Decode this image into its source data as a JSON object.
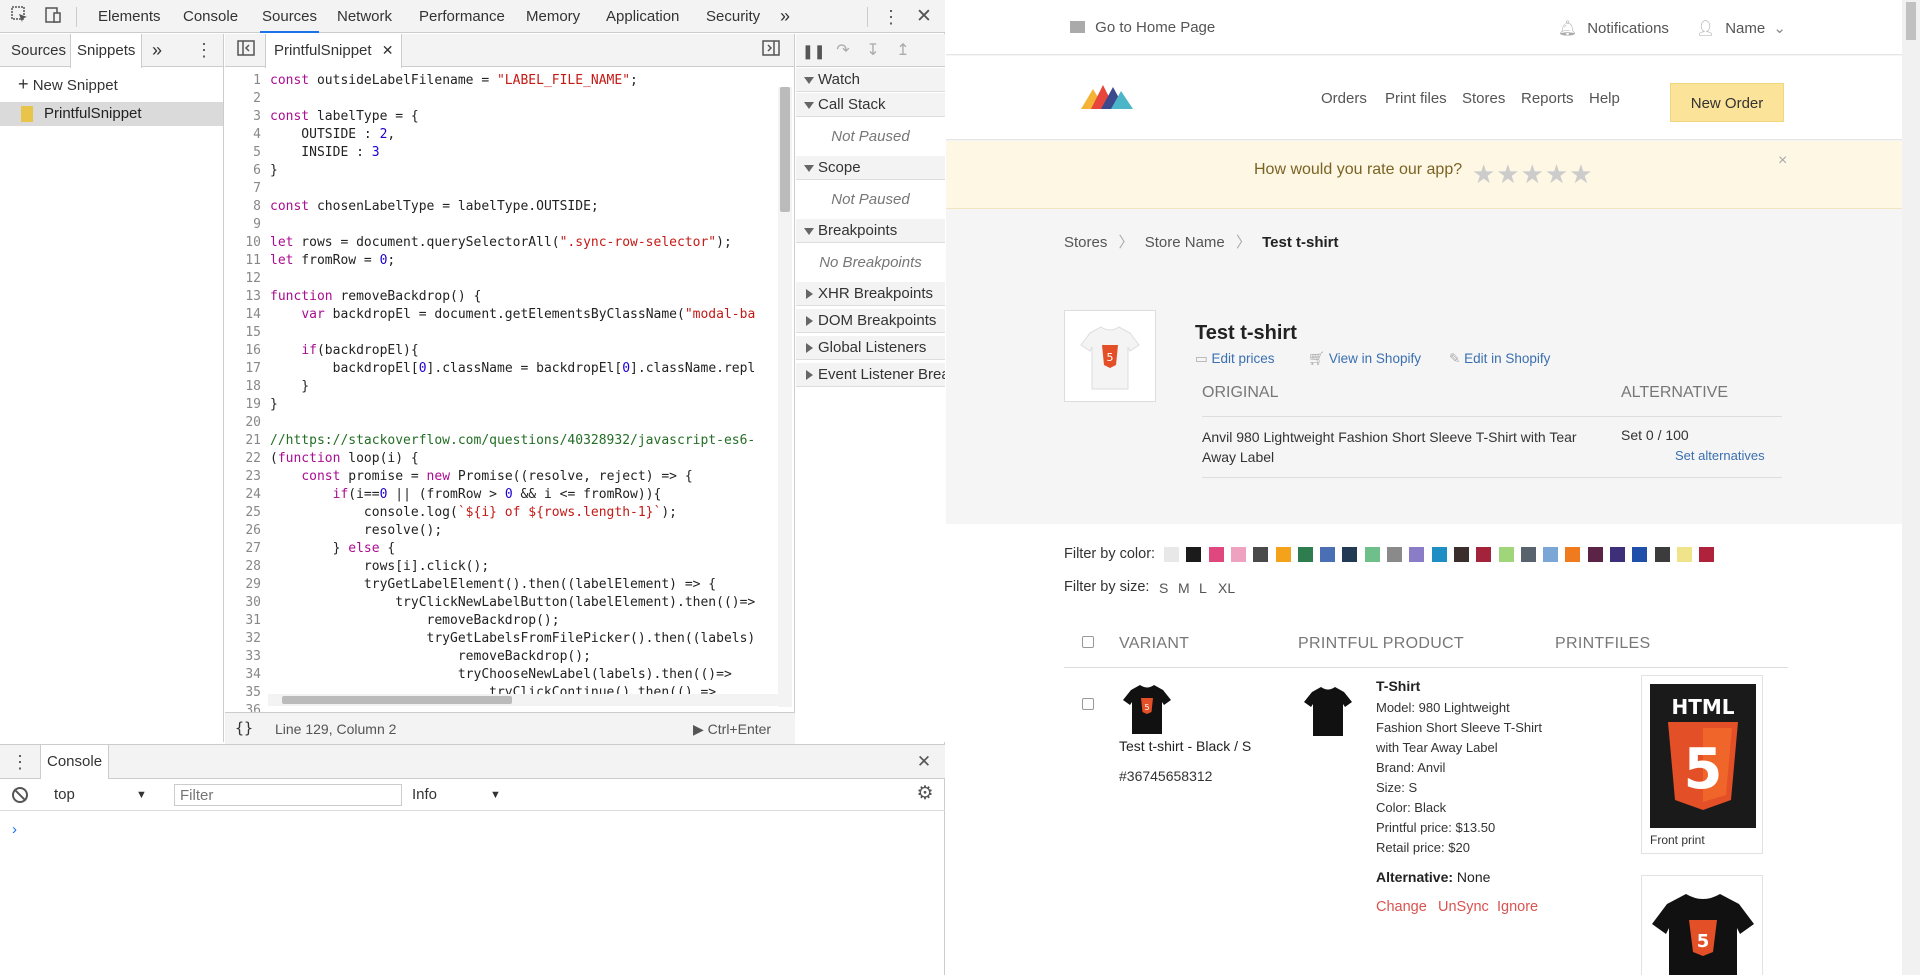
{
  "devtools": {
    "main_tabs": [
      "Elements",
      "Console",
      "Sources",
      "Network",
      "Performance",
      "Memory",
      "Application",
      "Security"
    ],
    "more_tabs": "»",
    "nav_tabs": [
      "Sources",
      "Snippets"
    ],
    "new_snippet": "New Snippet",
    "snippet_name": "PrintfulSnippet",
    "file_tab": "PrintfulSnippet",
    "status": {
      "position": "Line 129, Column 2",
      "run": "Ctrl+Enter"
    },
    "debugger": {
      "watch": "Watch",
      "call_stack": "Call Stack",
      "call_stack_body": "Not Paused",
      "scope": "Scope",
      "scope_body": "Not Paused",
      "breakpoints": "Breakpoints",
      "breakpoints_body": "No Breakpoints",
      "xhr": "XHR Breakpoints",
      "dom": "DOM Breakpoints",
      "global": "Global Listeners",
      "event": "Event Listener Breakpoints"
    },
    "console": {
      "tab": "Console",
      "context": "top",
      "filter_placeholder": "Filter",
      "level": "Info",
      "prompt": "›"
    }
  },
  "site": {
    "home_link": "Go to Home Page",
    "notifications": "Notifications",
    "user": "Name",
    "nav": [
      "Orders",
      "Print files",
      "Stores",
      "Reports",
      "Help"
    ],
    "new_order": "New Order",
    "rate_question": "How would you rate our app?",
    "stars": "★★★★★",
    "close": "×",
    "breadcrumb": [
      "Stores",
      "Store Name",
      "Test t-shirt"
    ],
    "product": {
      "title": "Test t-shirt",
      "actions": [
        "Edit prices",
        "View in Shopify",
        "Edit in Shopify"
      ],
      "col_original": "ORIGINAL",
      "col_alternative": "ALTERNATIVE",
      "original_name": "Anvil 980 Lightweight Fashion Short Sleeve T-Shirt with Tear Away Label",
      "alt_set": "Set 0 / 100",
      "alt_link": "Set alternatives"
    },
    "filter_color_label": "Filter by color:",
    "swatches": [
      "#e8e8e8",
      "#1b1b1b",
      "#e0477f",
      "#eea2c0",
      "#4a4a4a",
      "#f5a21b",
      "#2e7d4f",
      "#4a6fb5",
      "#233a55",
      "#6fbf8a",
      "#8a8a8a",
      "#8a7cc7",
      "#1e8ec4",
      "#3a2f2c",
      "#a3233a",
      "#a0d57a",
      "#58636e",
      "#7ba7d6",
      "#f07a1e",
      "#5b2345",
      "#3d2f7a",
      "#1f4fa8",
      "#3c3c3c",
      "#f0e48a",
      "#b0213c"
    ],
    "filter_size_label": "Filter by size:",
    "sizes": [
      "S",
      "M",
      "L",
      "XL"
    ],
    "table_headers": [
      "VARIANT",
      "PRINTFUL PRODUCT",
      "PRINTFILES"
    ],
    "variant": {
      "name": "Test t-shirt - Black / S",
      "id": "#36745658312",
      "product_title": "T-Shirt",
      "details": [
        "Model: 980 Lightweight Fashion Short Sleeve T-Shirt with Tear Away Label",
        "Brand: Anvil",
        "Size: S",
        "Color: Black",
        "Printful price: $13.50",
        "Retail price: $20"
      ],
      "alternative_label": "Alternative:",
      "alternative_value": "None",
      "actions": [
        "Change",
        "UnSync",
        "Ignore"
      ],
      "printfile_label": "Front print",
      "html_logo_text": "HTML"
    }
  }
}
